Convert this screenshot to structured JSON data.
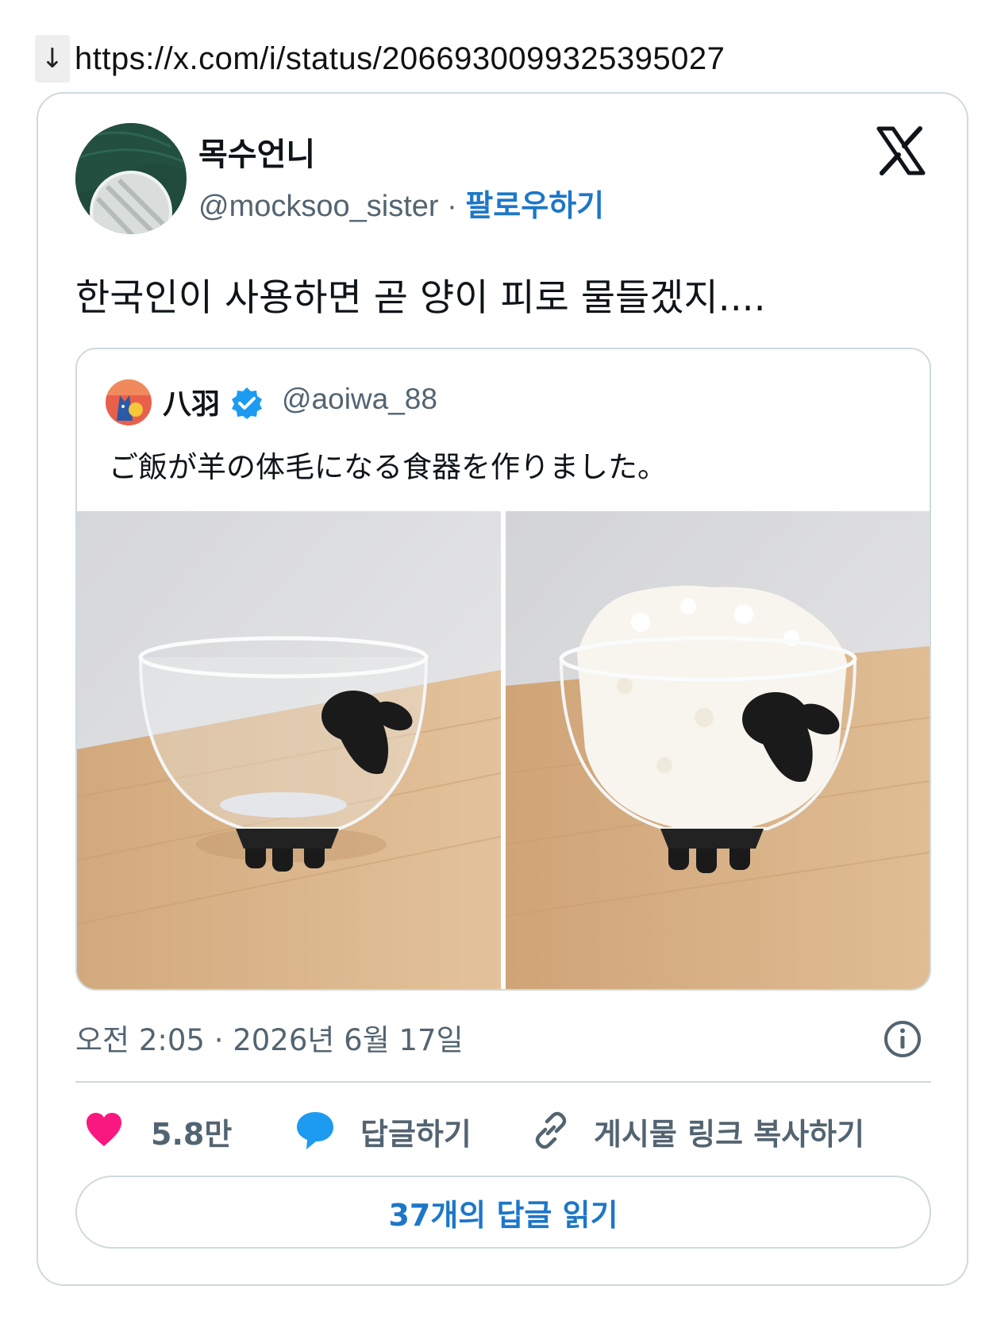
{
  "url_bar": {
    "arrow": "↓",
    "url": "https://x.com/i/status/2066930099325395027"
  },
  "tweet": {
    "author_name": "목수언니",
    "author_handle": "@mocksoo_sister",
    "separator": "·",
    "follow_label": "팔로우하기",
    "text": "한국인이 사용하면 곧 양이 피로 물들겠지....",
    "timestamp": "오전 2:05 · 2026년 6월 17일"
  },
  "quoted_tweet": {
    "author_name": "八羽",
    "author_handle": "@aoiwa_88",
    "text": "ご飯が羊の体毛になる食器を作りました。",
    "photos": [
      "empty-sheep-glass-bowl",
      "rice-filled-sheep-glass-bowl"
    ]
  },
  "actions": {
    "like_count": "5.8만",
    "reply_label": "답글하기",
    "copy_link_label": "게시물 링크 복사하기"
  },
  "read_replies_label": "37개의 답글 읽기",
  "icons": [
    "x-logo-icon",
    "verified-badge-icon",
    "info-icon",
    "heart-icon",
    "reply-bubble-icon",
    "link-icon"
  ],
  "colors": {
    "accent": "#1d77c8",
    "like": "#f91880",
    "reply": "#1d9bf0",
    "muted": "#536471"
  }
}
